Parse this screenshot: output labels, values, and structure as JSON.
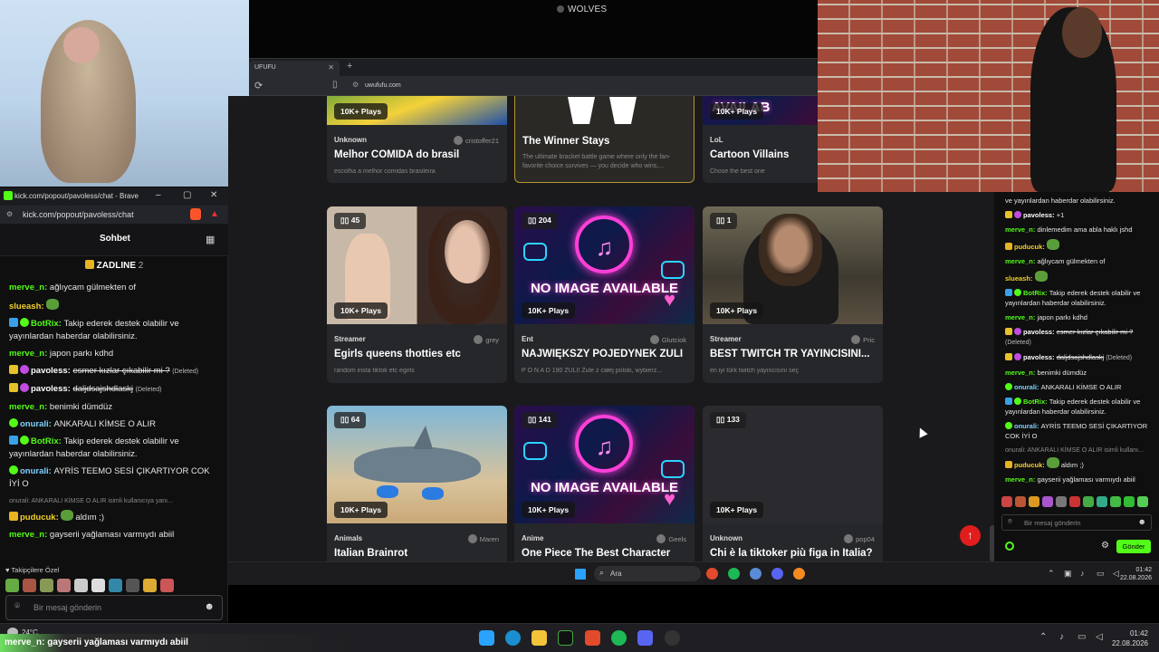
{
  "top_title": "WOLVES",
  "browser": {
    "tab_label": "UFUFU",
    "url": "uwufufu.com"
  },
  "cards_top": [
    {
      "plays": "10K+ Plays",
      "category": "Unknown",
      "author": "cristoffer21",
      "title": "Melhor COMIDA do brasil",
      "desc": "escolha a melhor comidas brasileira"
    },
    {
      "title": "The Winner Stays",
      "desc": "The ultimate bracket battle game where only the fan-favorite choice survives — you decide who wins,..."
    },
    {
      "plays": "10K+ Plays",
      "category": "LoL",
      "title": "Cartoon Villains",
      "desc": "Chose the best one",
      "banner": "AVAILAB"
    }
  ],
  "cards_mid": [
    {
      "count": "45",
      "plays": "10K+ Plays",
      "category": "Streamer",
      "author": "grey",
      "title": "Egirls queens thotties etc",
      "desc": "random insta tiktok etc egirls"
    },
    {
      "count": "204",
      "plays": "10K+ Plays",
      "category": "Ent",
      "author": "Glutciok",
      "title": "NAJWIĘKSZY POJEDYNEK ŻULI",
      "desc": "P O N A D 190 ŻULI! Żule z całej polski, wybierz...",
      "noimg": "NO IMAGE AVAILABLE"
    },
    {
      "count": "1",
      "plays": "10K+ Plays",
      "category": "Streamer",
      "author": "Pric",
      "title": "BEST TWİTCH TR YAYINCISINI...",
      "desc": "en iyi türk twitch yayıncısını seç"
    }
  ],
  "cards_bot": [
    {
      "count": "64",
      "plays": "10K+ Plays",
      "category": "Animals",
      "author": "Maren",
      "title": "Italian Brainrot"
    },
    {
      "count": "141",
      "plays": "10K+ Plays",
      "category": "Anime",
      "author": "Geels",
      "title": "One Piece The Best Character",
      "noimg": "NO IMAGE AVAILABLE"
    },
    {
      "count": "133",
      "plays": "10K+ Plays",
      "category": "Unknown",
      "author": "pop04",
      "title": "Chi è la tiktoker più figa in Italia?"
    }
  ],
  "left_chat": {
    "window_title": "kick.com/popout/pavoless/chat - Brave",
    "address": "kick.com/popout/pavoless/chat",
    "header": "Sohbet",
    "pinned_name": "ZADLINE",
    "pinned_count": "2",
    "messages": [
      {
        "user": "merve_n",
        "color": "#53fc18",
        "text": "ağlıycam gülmekten of"
      },
      {
        "user": "slueash",
        "color": "#f2d02a",
        "text": ""
      },
      {
        "user": "BotRix",
        "color": "#53fc18",
        "text": "Takip ederek destek olabilir ve yayınlardan haberdar olabilirsiniz."
      },
      {
        "user": "merve_n",
        "color": "#53fc18",
        "text": "japon parkı kdhd"
      },
      {
        "user": "pavoless",
        "color": "#ffffff",
        "text": "esmer kızlar çıkabilir mi ?",
        "note": "(Deleted)"
      },
      {
        "user": "pavoless",
        "color": "#ffffff",
        "text": "daljdsajshdlaskj",
        "note": "(Deleted)"
      },
      {
        "user": "merve_n",
        "color": "#53fc18",
        "text": "benimki dümdüz"
      },
      {
        "user": "onurali",
        "color": "#7fd3ff",
        "text": "ANKARALI KİMSE O ALIR"
      },
      {
        "user": "BotRix",
        "color": "#53fc18",
        "text": "Takip ederek destek olabilir ve yayınlardan haberdar olabilirsiniz."
      },
      {
        "user": "onurali",
        "color": "#7fd3ff",
        "text": "AYRİS TEEMO SESİ ÇIKARTIYOR COK İYİ O"
      },
      {
        "reply": "onurali: ANKARALI KİMSE O ALIR isimli kullanıcıya yanı...",
        "user": "puducuk",
        "color": "#f2d02a",
        "text": "aldım ;)"
      },
      {
        "user": "merve_n",
        "color": "#53fc18",
        "text": "gayserii yağlaması varmıydı abiil"
      }
    ],
    "emotes_label": "Takipçilere Özel",
    "input_placeholder": "Bir mesaj gönderin"
  },
  "right_chat": {
    "messages": [
      {
        "user": "",
        "color": "#ffffff",
        "text": "ve yayınlardan haberdar olabilirsiniz."
      },
      {
        "user": "pavoless",
        "color": "#ffffff",
        "text": "+1"
      },
      {
        "user": "merve_n",
        "color": "#53fc18",
        "text": "dinlemedim ama abla haklı jshd"
      },
      {
        "user": "puducuk",
        "color": "#f2d02a",
        "text": ""
      },
      {
        "user": "merve_n",
        "color": "#53fc18",
        "text": "ağlıycam gülmekten of"
      },
      {
        "user": "slueash",
        "color": "#f2d02a",
        "text": ""
      },
      {
        "user": "BotRix",
        "color": "#53fc18",
        "text": "Takip ederek destek olabilir ve yayınlardan haberdar olabilirsiniz."
      },
      {
        "user": "merve_n",
        "color": "#53fc18",
        "text": "japon parkı kdhd"
      },
      {
        "user": "pavoless",
        "color": "#ffffff",
        "text": "esmer kızlar çıkabilir mi ?",
        "note": "(Deleted)"
      },
      {
        "user": "pavoless",
        "color": "#ffffff",
        "text": "daljdsajshdlaskj",
        "note": "(Deleted)"
      },
      {
        "user": "merve_n",
        "color": "#53fc18",
        "text": "benimki dümdüz"
      },
      {
        "user": "onurali",
        "color": "#7fd3ff",
        "text": "ANKARALI KİMSE O ALIR"
      },
      {
        "user": "BotRix",
        "color": "#53fc18",
        "text": "Takip ederek destek olabilir ve yayınlardan haberdar olabilirsiniz."
      },
      {
        "user": "onurali",
        "color": "#7fd3ff",
        "text": "AYRİS TEEMO SESİ ÇIKARTIYOR COK İYİ O"
      },
      {
        "reply": "onurali: ANKARALI KİMSE O ALIR isimli kullanı...",
        "user": "puducuk",
        "color": "#f2d02a",
        "text": "aldım ;)"
      },
      {
        "user": "merve_n",
        "color": "#53fc18",
        "text": "gayserii yağlaması varmıydı abiil"
      }
    ],
    "input_placeholder": "Bir mesaj gönderin",
    "send_label": "Gönder"
  },
  "inner_taskbar": {
    "search": "Ara",
    "time": "01:42",
    "date": "22.08.2026"
  },
  "taskbar": {
    "weather": "24°C",
    "time": "01:42",
    "date": "22.08.2026"
  },
  "ticker": {
    "user": "merve_n",
    "text": ": gayserii yağlaması varmıydı abiil"
  },
  "colors": {
    "accent": "#53fc18",
    "scroll_up": "#e11d1d"
  }
}
